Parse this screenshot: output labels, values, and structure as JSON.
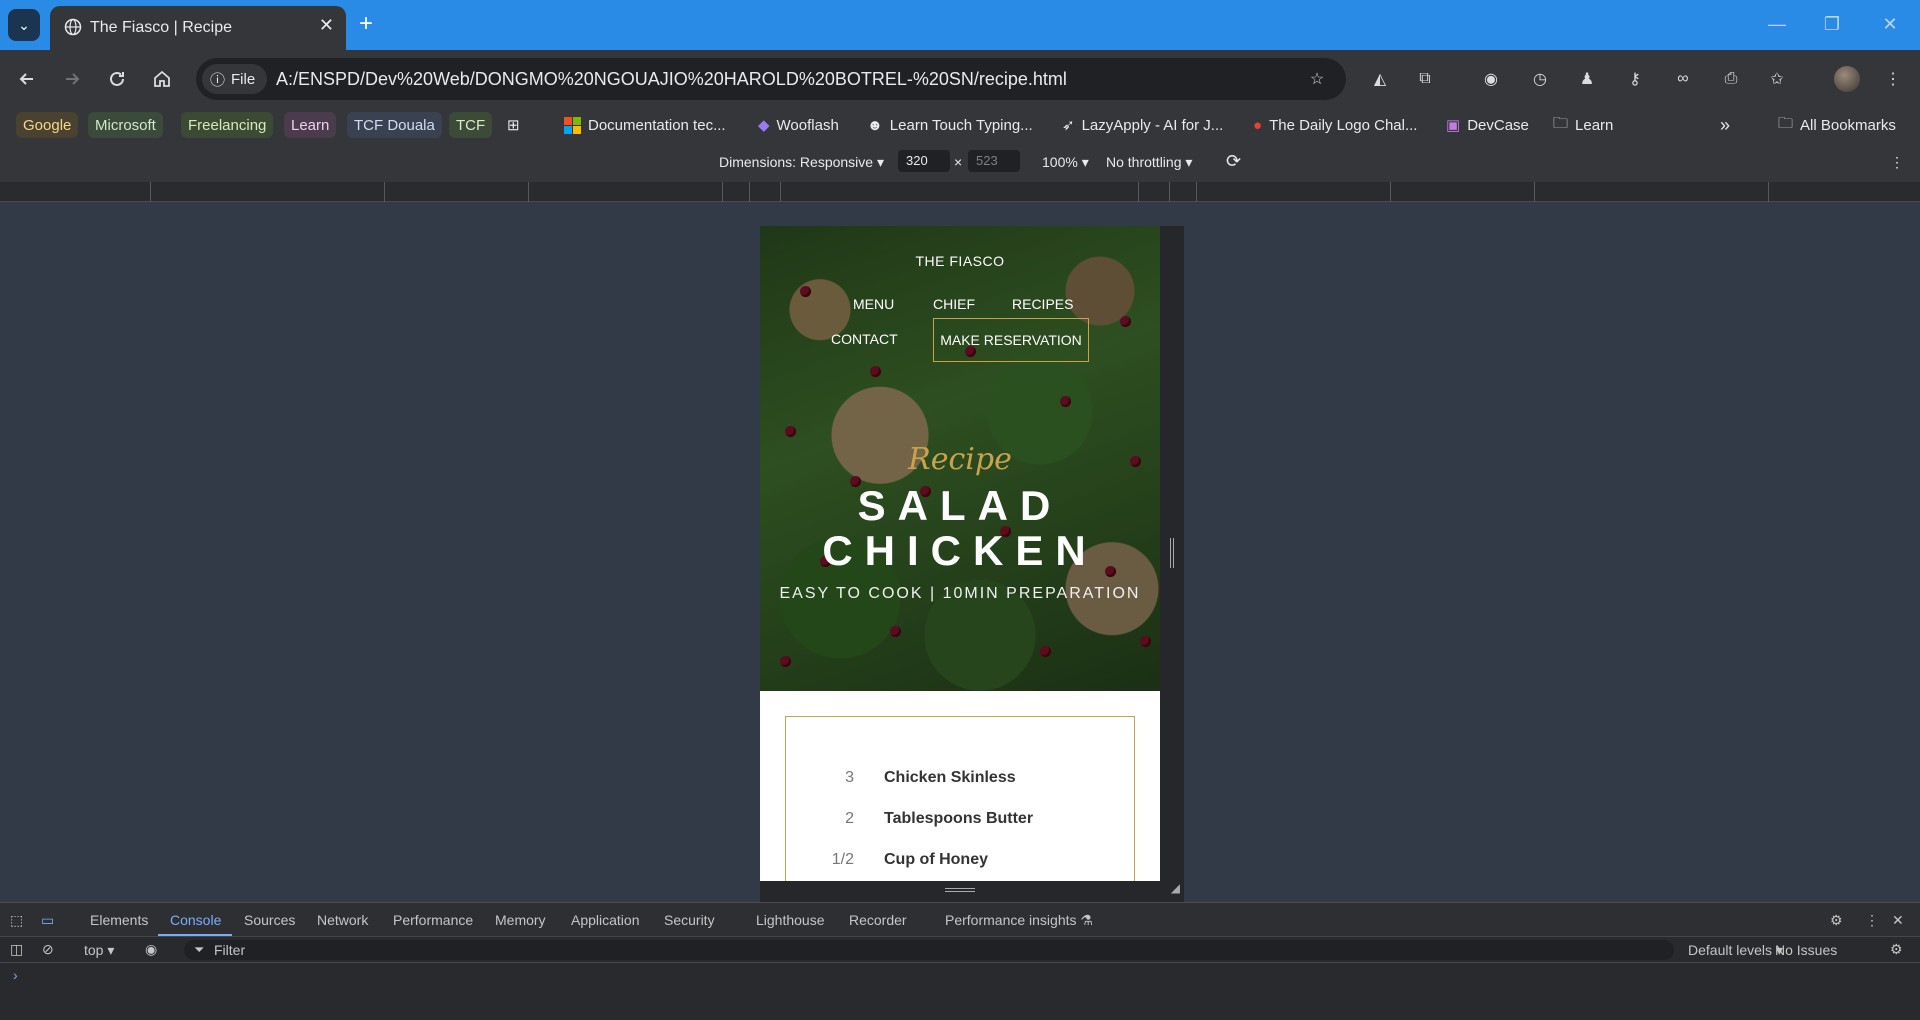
{
  "browser": {
    "tab_title": "The Fiasco | Recipe",
    "address_chip": "File",
    "url": "A:/ENSPD/Dev%20Web/DONGMO%20NGOUAJIO%20HAROLD%20BOTREL-%20SN/recipe.html"
  },
  "bookmarks": {
    "items": [
      "Google",
      "Microsoft",
      "Freelancing",
      "Learn",
      "TCF Douala",
      "TCF",
      "Documentation tec...",
      "Wooflash",
      "Learn Touch Typing...",
      "LazyApply - AI for J...",
      "The Daily Logo Chal...",
      "DevCase",
      "Learn"
    ],
    "all_bookmarks": "All Bookmarks",
    "more": "»"
  },
  "device_toolbar": {
    "dimensions": "Dimensions: Responsive",
    "width": "320",
    "times": "×",
    "height": "523",
    "zoom": "100%",
    "throttling": "No throttling"
  },
  "page": {
    "brand": "THE FIASCO",
    "nav": [
      "MENU",
      "CHIEF",
      "RECIPES",
      "CONTACT"
    ],
    "reservation": "MAKE RESERVATION",
    "script_label": "Recipe",
    "dish_line1": "SALAD",
    "dish_line2": "CHICKEN",
    "subtitle": "EASY TO COOK | 10MIN PREPARATION",
    "ingredients": [
      {
        "qty": "3",
        "name": "Chicken Skinless"
      },
      {
        "qty": "2",
        "name": "Tablespoons Butter"
      },
      {
        "qty": "1/2",
        "name": "Cup of Honey"
      }
    ]
  },
  "devtools": {
    "tabs": [
      "Elements",
      "Console",
      "Sources",
      "Network",
      "Performance",
      "Memory",
      "Application",
      "Security",
      "Lighthouse",
      "Recorder",
      "Performance insights"
    ],
    "context": "top",
    "filter_placeholder": "Filter",
    "levels": "Default levels",
    "issues": "No Issues",
    "prompt": "›"
  },
  "colors": {
    "accent_gold": "#c9a24c",
    "tabstrip_blue": "#2a8be6",
    "devtools_accent": "#7cacf8"
  }
}
